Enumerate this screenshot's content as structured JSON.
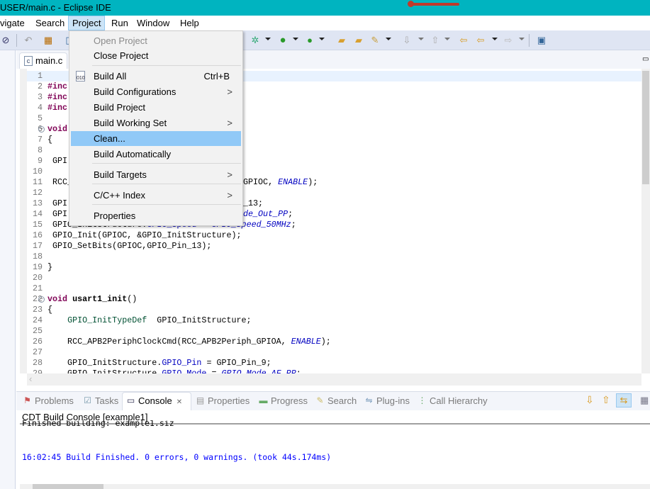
{
  "window": {
    "title": "USER/main.c - Eclipse IDE"
  },
  "menubar": [
    "vigate",
    "Search",
    "Project",
    "Run",
    "Window",
    "Help"
  ],
  "editor": {
    "tab": "main.c",
    "lines": [
      {
        "n": "1",
        "l": "",
        "r": ""
      },
      {
        "n": "2",
        "l": "#inc",
        "r": ""
      },
      {
        "n": "3",
        "l": "#inc",
        "r": ""
      },
      {
        "n": "4",
        "l": "#inc",
        "r": ""
      },
      {
        "n": "5",
        "l": "",
        "r": ""
      },
      {
        "n": "6",
        "l": "void",
        "r": ""
      },
      {
        "n": "7",
        "l": "{",
        "r": ""
      },
      {
        "n": "8",
        "l": "",
        "r": ""
      },
      {
        "n": "9",
        "l": " GPI",
        "r": ""
      },
      {
        "n": "10",
        "l": "",
        "r": ""
      },
      {
        "n": "11",
        "l": " RCC_",
        "r": "GPIOC, ENABLE);"
      },
      {
        "n": "12",
        "l": "",
        "r": ""
      },
      {
        "n": "13",
        "l": " GPI",
        "r": "_13;"
      },
      {
        "n": "14",
        "l": " GPI",
        "r": "de_Out_PP;"
      },
      {
        "n": "15",
        "l": " GPIO_InitStructure.GPIO_Speed = GPIO_Speed_50MHz;",
        "r": ""
      },
      {
        "n": "16",
        "l": " GPIO_Init(GPIOC, &GPIO_InitStructure);",
        "r": ""
      },
      {
        "n": "17",
        "l": " GPIO_SetBits(GPIOC,GPIO_Pin_13);",
        "r": ""
      },
      {
        "n": "18",
        "l": "",
        "r": ""
      },
      {
        "n": "19",
        "l": "}",
        "r": ""
      },
      {
        "n": "20",
        "l": "",
        "r": ""
      },
      {
        "n": "21",
        "l": "",
        "r": ""
      },
      {
        "n": "22",
        "l": "void usart1_init()",
        "r": ""
      },
      {
        "n": "23",
        "l": "{",
        "r": ""
      },
      {
        "n": "24",
        "l": "    GPIO_InitTypeDef  GPIO_InitStructure;",
        "r": ""
      },
      {
        "n": "25",
        "l": "",
        "r": ""
      },
      {
        "n": "26",
        "l": "    RCC_APB2PeriphClockCmd(RCC_APB2Periph_GPIOA, ENABLE);",
        "r": ""
      },
      {
        "n": "27",
        "l": "",
        "r": ""
      },
      {
        "n": "28",
        "l": "    GPIO_InitStructure.GPIO_Pin = GPIO_Pin_9;",
        "r": ""
      },
      {
        "n": "29",
        "l": "    GPIO_InitStructure.GPIO_Mode = GPIO_Mode_AF_PP;",
        "r": ""
      }
    ]
  },
  "project_menu": {
    "items": [
      {
        "label": "Open Project",
        "disabled": true
      },
      {
        "label": "Close Project"
      },
      {
        "label": "Build All",
        "shortcut": "Ctrl+B",
        "icon": "binary-build-icon"
      },
      {
        "label": "Build Configurations",
        "submenu": true
      },
      {
        "label": "Build Project"
      },
      {
        "label": "Build Working Set",
        "submenu": true
      },
      {
        "label": "Clean...",
        "highlighted": true
      },
      {
        "label": "Build Automatically"
      },
      {
        "label": "Build Targets",
        "submenu": true
      },
      {
        "label": "C/C++ Index",
        "submenu": true
      },
      {
        "label": "Properties"
      }
    ],
    "submenu_glyph": ">"
  },
  "bottom_panel": {
    "tabs": [
      "Problems",
      "Tasks",
      "Console",
      "Properties",
      "Progress",
      "Search",
      "Plug-ins",
      "Call Hierarchy"
    ],
    "active_tab": "Console",
    "console_title": "CDT Build Console [example1]",
    "console_lines": [
      "Finished building: example1.siz",
      "16:02:45 Build Finished. 0 errors, 0 warnings. (took 44s.174ms)"
    ],
    "close_glyph": "✕"
  },
  "colors": {
    "titlebar": "#00b4c0",
    "menu_highlight": "#91c9f7",
    "console_info": "#0000ff",
    "keyword": "#7f0055"
  }
}
